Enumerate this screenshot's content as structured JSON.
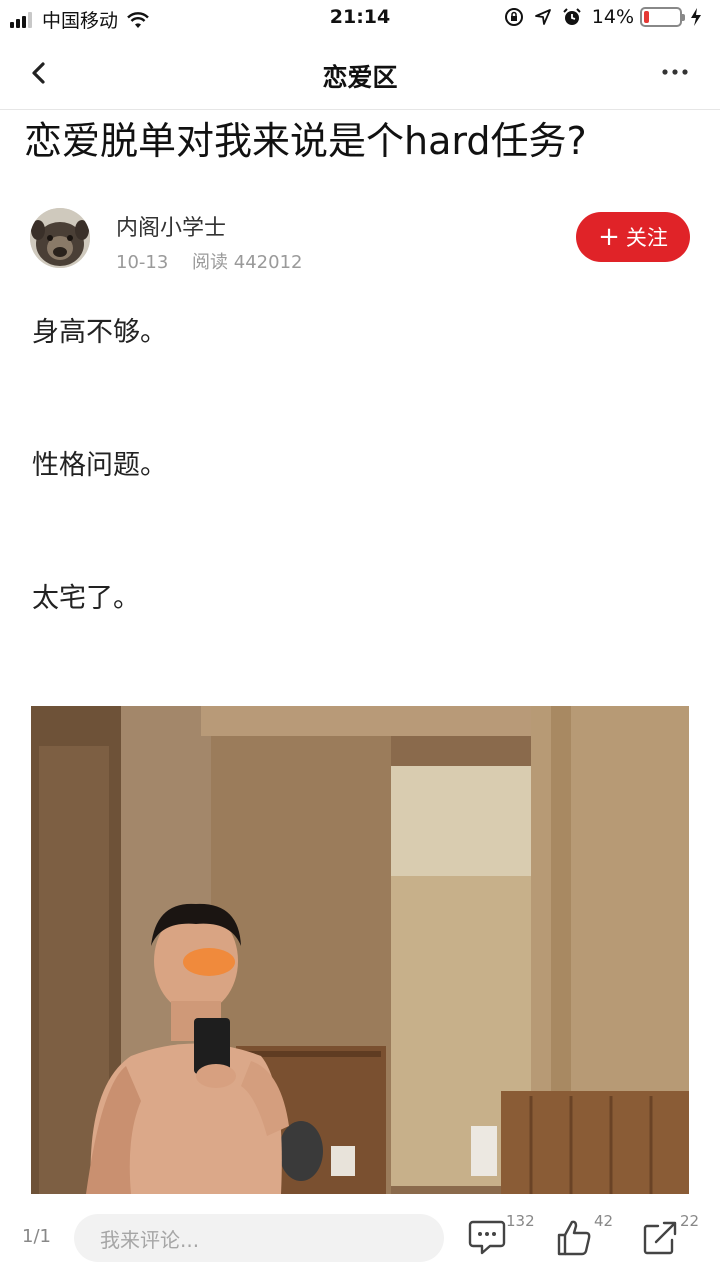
{
  "status_bar": {
    "carrier": "中国移动",
    "time": "21:14",
    "battery_percent": "14%",
    "battery_level": 0.14,
    "battery_color": "#e53935"
  },
  "nav": {
    "back_icon": "chevron-left-icon",
    "title": "恋爱区",
    "more_icon": "more-dots-icon"
  },
  "article": {
    "title": "恋爱脱单对我来说是个hard任务?",
    "author": {
      "name": "内阁小学士",
      "date": "10-13",
      "reads": "阅读 442012"
    },
    "follow_label": "关注",
    "follow_color": "#e02328",
    "paragraphs": [
      "身高不够。",
      "性格问题。",
      "太宅了。"
    ]
  },
  "bottom_bar": {
    "page_indicator": "1/1",
    "comment_placeholder": "我来评论...",
    "comments_count": "132",
    "likes_count": "42",
    "shares_count": "22"
  }
}
